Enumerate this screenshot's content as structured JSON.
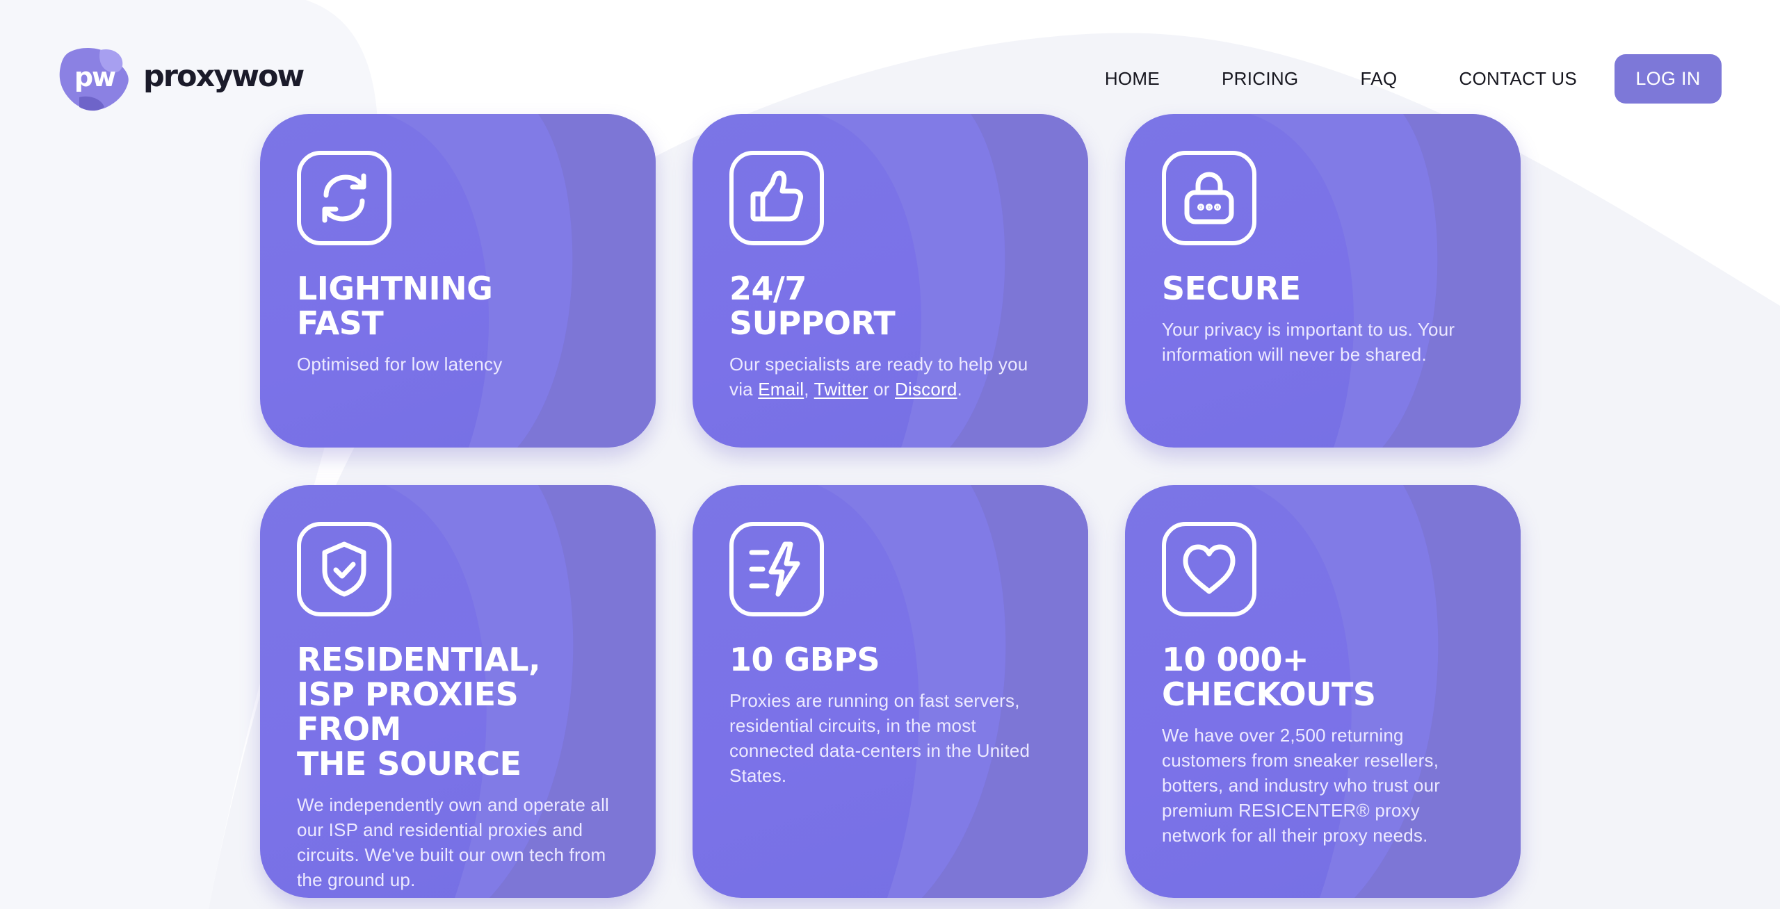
{
  "brand": {
    "name": "proxywow",
    "logo_initials": "pw"
  },
  "nav": {
    "items": [
      "HOME",
      "PRICING",
      "FAQ",
      "CONTACT US"
    ],
    "login_label": "LOG IN"
  },
  "colors": {
    "accent": "#7d78d8",
    "card": "#7b75e6",
    "text_dark": "#16161f"
  },
  "cards": [
    {
      "icon": "refresh-icon",
      "title": "LIGHTNING\nFAST",
      "description": "Optimised for low latency"
    },
    {
      "icon": "thumbs-up-icon",
      "title": "24/7\nSUPPORT",
      "description_prefix": "Our specialists are ready to help you via ",
      "links": [
        "Email",
        "Twitter",
        "Discord"
      ],
      "separator_1": ", ",
      "separator_2": " or ",
      "description_suffix": "."
    },
    {
      "icon": "lock-icon",
      "title": "SECURE",
      "description": "Your privacy is important to us. Your information will never be shared."
    },
    {
      "icon": "shield-check-icon",
      "title": "RESIDENTIAL,\nISP PROXIES FROM\nTHE SOURCE",
      "description": "We independently own and operate all our ISP and residential proxies and circuits. We've built our own tech from the ground up."
    },
    {
      "icon": "lightning-speed-icon",
      "title": "10 GBPS",
      "description": "Proxies are running on fast servers, residential circuits, in the most connected data-centers in the United States."
    },
    {
      "icon": "heart-icon",
      "title": "10 000+\nCHECKOUTS",
      "description": "We have over 2,500 returning customers from sneaker resellers, botters, and industry who trust our premium RESICENTER® proxy network for all their proxy needs."
    }
  ]
}
